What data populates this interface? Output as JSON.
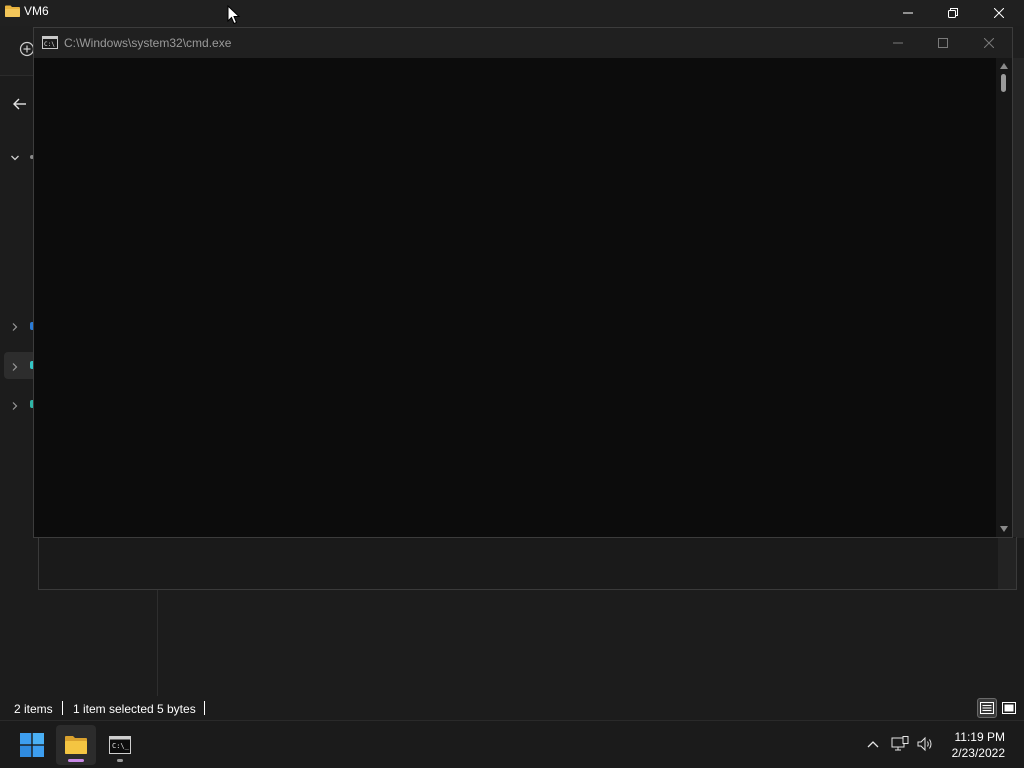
{
  "explorer": {
    "title": "VM6",
    "status": {
      "items_count": "2 items",
      "selection": "1 item selected",
      "size": "5 bytes"
    },
    "view_modes": [
      "details-view-icon",
      "large-icons-view-icon"
    ]
  },
  "cmd": {
    "title": "C:\\Windows\\system32\\cmd.exe",
    "content": ""
  },
  "taskbar": {
    "apps": [
      "start-icon",
      "file-explorer-icon",
      "command-prompt-icon"
    ],
    "tray": [
      "show-hidden-icons-chevron",
      "network-icon",
      "volume-icon"
    ],
    "time": "11:19 PM",
    "date": "2/23/2022"
  },
  "colors": {
    "accent_indicator": "#c889e6",
    "folder": "#e8b33e",
    "windows_logo": "#3d9ef0"
  }
}
